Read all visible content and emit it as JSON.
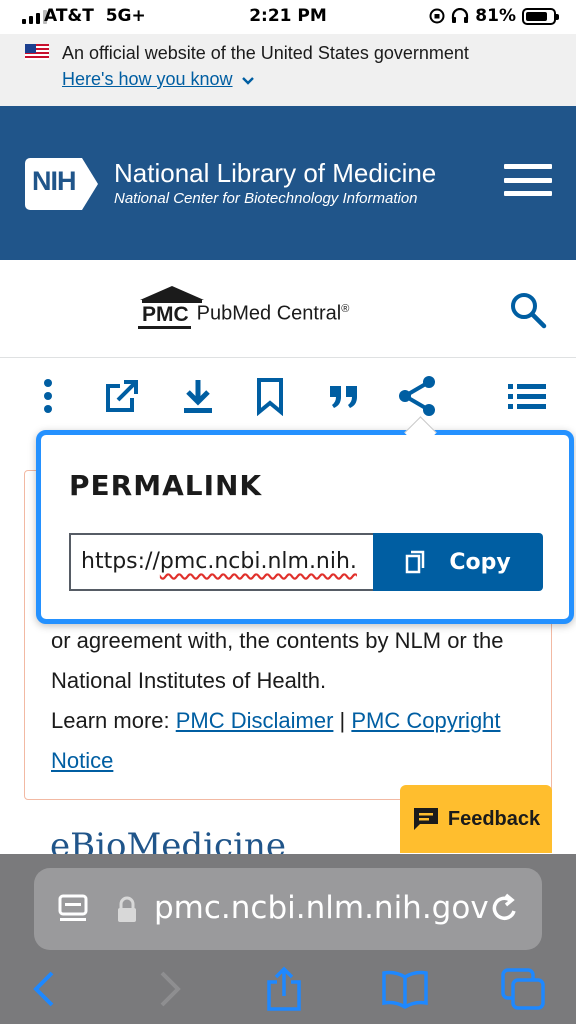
{
  "status_bar": {
    "carrier": "AT&T",
    "network": "5G+",
    "time": "2:21 PM",
    "battery": "81%",
    "battery_level": 0.81
  },
  "gov_banner": {
    "text": "An official website of the United States government",
    "link": "Here's how you know"
  },
  "nih_header": {
    "logo_text": "NIH",
    "org_name": "National Library of Medicine",
    "subtitle": "National Center for Biotechnology Information"
  },
  "pmc": {
    "logo_text": "PMC",
    "name": "PubMed Central",
    "reg": "®"
  },
  "toolbar": {
    "icons": [
      "more-vert-icon",
      "open-external-icon",
      "download-icon",
      "bookmark-icon",
      "cite-icon",
      "share-icon",
      "toc-icon"
    ]
  },
  "article": {
    "text_1": "or agreement with, the contents by NLM or the National Institutes of Health.",
    "learn_more": "Learn more: ",
    "link_disclaimer": "PMC Disclaimer",
    "separator": " | ",
    "link_copyright": "PMC Copyright Notice",
    "journal_partial": "eBioMedicine"
  },
  "permalink": {
    "title": "PERMALINK",
    "url_visible_1": "https://",
    "url_visible_2": "pmc.ncbi.nlm.nih.",
    "copy_label": "Copy"
  },
  "feedback": {
    "label": "Feedback"
  },
  "safari": {
    "url": "pmc.ncbi.nlm.nih.gov"
  },
  "colors": {
    "nih_blue": "#20558a",
    "link_blue": "#005ea2",
    "focus_blue": "#2491ff",
    "feedback_yellow": "#ffbe2e"
  }
}
